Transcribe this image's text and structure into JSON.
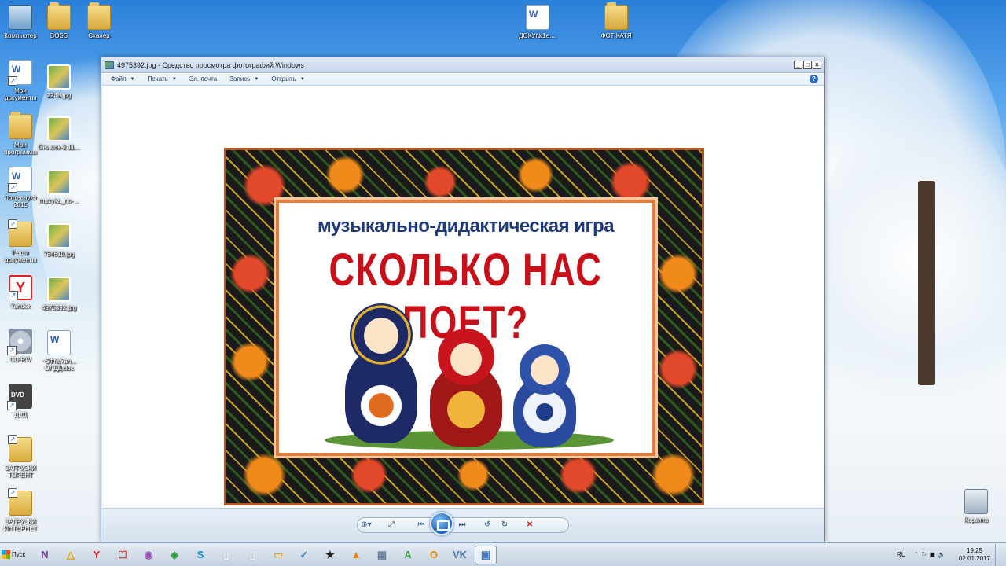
{
  "desktop": {
    "icons": [
      {
        "label": "Компьютер"
      },
      {
        "label": "BOSS"
      },
      {
        "label": "Сканер"
      },
      {
        "label": "ДОКУ№1е...."
      },
      {
        "label": "ФОТ КАТЯ"
      },
      {
        "label": "Мои документы"
      },
      {
        "label": "2248.jpg"
      },
      {
        "label": "Мои программы"
      },
      {
        "label": "Снимок-2.11..."
      },
      {
        "label": "Лото-внуки 2015"
      },
      {
        "label": "muzyka_no-..."
      },
      {
        "label": "Наши документы"
      },
      {
        "label": "784610.jpg"
      },
      {
        "label": "Yandex"
      },
      {
        "label": "4975392.jpg"
      },
      {
        "label": "CD-RW"
      },
      {
        "label": "~$Ф№7вл... ОЛДД.doc"
      },
      {
        "label": "ДВД"
      },
      {
        "label": "ЗАГРУЗКИ ТОРЕНТ"
      },
      {
        "label": "ЗАГРУЗКИ ИНТЕРНЕТ"
      },
      {
        "label": "Корзина"
      }
    ]
  },
  "window": {
    "title": "4975392.jpg - Средство просмотра фотографий Windows",
    "menu": [
      "Файл",
      "Печать",
      "Эл. почта",
      "Запись",
      "Открыть"
    ],
    "buttons": {
      "minimize": "_",
      "maximize": "□",
      "close": "×",
      "help": "?"
    }
  },
  "poster": {
    "subtitle": "музыкально-дидактическая игра",
    "title": "СКОЛЬКО НАС ПОЕТ?"
  },
  "controls": {
    "zoom": "⊕▾",
    "fit": "⤢",
    "prev": "⏮",
    "next": "⏭",
    "rotate_ccw": "↺",
    "rotate_cw": "↻",
    "delete": "✕"
  },
  "taskbar": {
    "start_label": "Пуск",
    "apps": [
      {
        "icon": "onenote-icon",
        "glyph": "N",
        "color": "#7b3fa0"
      },
      {
        "icon": "archicad-icon",
        "glyph": "△",
        "color": "#e0a000"
      },
      {
        "icon": "yandex-browser-icon",
        "glyph": "Y",
        "color": "#e02020"
      },
      {
        "icon": "pdf-reader-icon",
        "glyph": "⏍",
        "color": "#c4261d"
      },
      {
        "icon": "media-player-icon",
        "glyph": "◉",
        "color": "#9a4fb5"
      },
      {
        "icon": "chrome-icon",
        "glyph": "◈",
        "color": "#2a9a3a"
      },
      {
        "icon": "skype-icon",
        "glyph": "S",
        "color": "#1d8fd6"
      },
      {
        "icon": "blank-doc-icon",
        "glyph": "▯",
        "color": "#ffffff"
      },
      {
        "icon": "notepad-icon",
        "glyph": "▯",
        "color": "#ffffff"
      },
      {
        "icon": "explorer-icon",
        "glyph": "▭",
        "color": "#d9a93c"
      },
      {
        "icon": "checklist-icon",
        "glyph": "✓",
        "color": "#3a7fd0"
      },
      {
        "icon": "camera-app-icon",
        "glyph": "★",
        "color": "#222222"
      },
      {
        "icon": "vlc-icon",
        "glyph": "▲",
        "color": "#f07a00"
      },
      {
        "icon": "calculator-icon",
        "glyph": "▦",
        "color": "#6a7f9a"
      },
      {
        "icon": "a-app-icon",
        "glyph": "A",
        "color": "#3aa03a"
      },
      {
        "icon": "odnoklassniki-icon",
        "glyph": "О",
        "color": "#f28a00"
      },
      {
        "icon": "vk-icon",
        "glyph": "VK",
        "color": "#4a76a8"
      },
      {
        "icon": "photo-viewer-icon",
        "glyph": "▣",
        "color": "#3c77c0"
      }
    ],
    "language": "RU",
    "time": "19:25",
    "date": "02.01.2017"
  }
}
